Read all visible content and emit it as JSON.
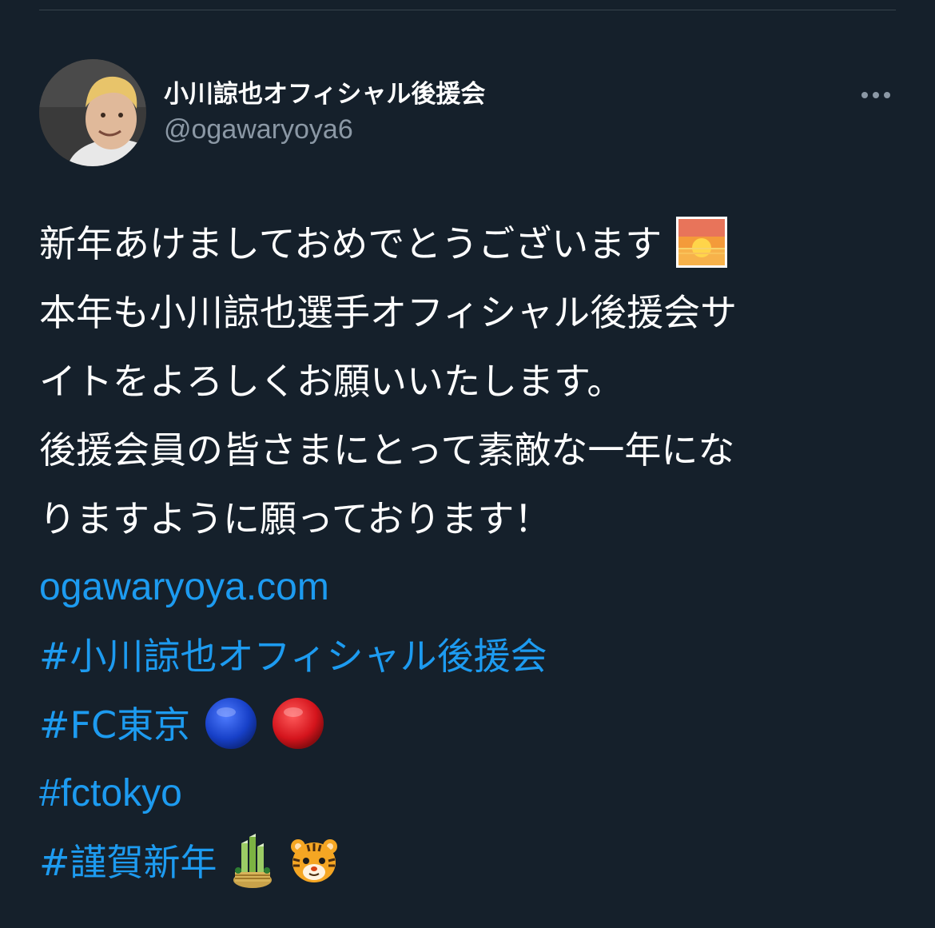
{
  "tweet": {
    "display_name": "小川諒也オフィシャル後援会",
    "handle": "@ogawaryoya6",
    "lines": [
      "新年あけましておめでとうございます",
      "本年も小川諒也選手オフィシャル後援会サ",
      "イトをよろしくお願いいたします。",
      "後援会員の皆さまにとって素敵な一年にな",
      "りますように願っております！"
    ],
    "link_url": "ogawaryoya.com",
    "hashtags": [
      "#小川諒也オフィシャル後援会",
      "#FC東京",
      "#fctokyo",
      "#謹賀新年"
    ],
    "emojis": {
      "line1": [
        "sunrise-emoji"
      ],
      "hashtag2": [
        "blue-circle-emoji",
        "red-circle-emoji"
      ],
      "hashtag4": [
        "kadomatsu-emoji",
        "tiger-face-emoji"
      ]
    }
  },
  "colors": {
    "background": "#15202b",
    "link": "#1d9bf0",
    "secondary_text": "#8b98a5",
    "divider": "#38444d"
  },
  "icons": {
    "more": "more-options-icon"
  }
}
